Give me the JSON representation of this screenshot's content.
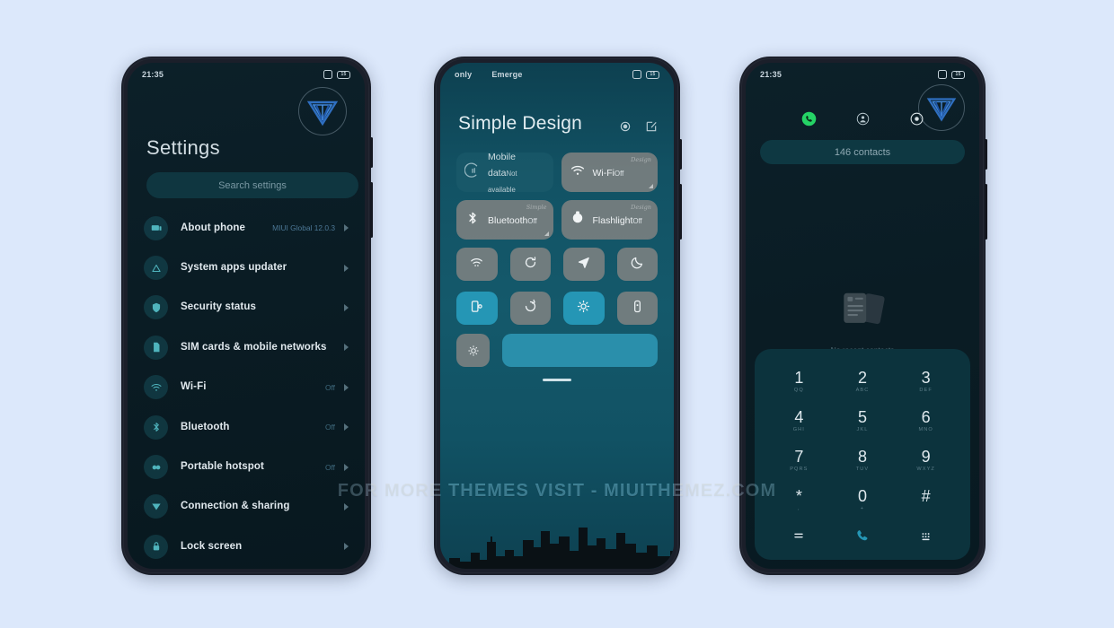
{
  "watermark": "FOR MORE THEMES VISIT - MIUITHEMEZ.COM",
  "colors": {
    "page_bg": "#dce8fb",
    "frame": "#1b1f2a",
    "settings_bg": "#0a1c24",
    "cc_bg": "#125264",
    "accent_teal": "#2596b5",
    "logo_blue": "#2f6fc0",
    "value_blue": "#4c7896"
  },
  "settings_phone": {
    "statusbar": {
      "time": "21:35",
      "icons": [
        "alarm-icon",
        "battery-icon"
      ],
      "battery_level": "15"
    },
    "logo": "miui-themez-logo",
    "title": "Settings",
    "search": {
      "placeholder": "Search settings"
    },
    "items": [
      {
        "icon": "about-phone-icon",
        "label": "About phone",
        "value": "MIUI Global 12.0.3",
        "value_style": "accent"
      },
      {
        "icon": "triangle-update-icon",
        "label": "System apps updater",
        "value": "",
        "value_style": "none"
      },
      {
        "icon": "shield-icon",
        "label": "Security status",
        "value": "",
        "value_style": "none"
      },
      {
        "icon": "sim-card-icon",
        "label": "SIM cards & mobile networks",
        "value": "",
        "value_style": "none"
      },
      {
        "icon": "wifi-icon",
        "label": "Wi-Fi",
        "value": "Off",
        "value_style": "dim"
      },
      {
        "icon": "bluetooth-icon",
        "label": "Bluetooth",
        "value": "Off",
        "value_style": "dim"
      },
      {
        "icon": "hotspot-icon",
        "label": "Portable hotspot",
        "value": "Off",
        "value_style": "dim"
      },
      {
        "icon": "connection-sharing-icon",
        "label": "Connection & sharing",
        "value": "",
        "value_style": "none"
      },
      {
        "icon": "lock-icon",
        "label": "Lock screen",
        "value": "",
        "value_style": "none"
      }
    ]
  },
  "control_center_phone": {
    "statusbar": {
      "carrier_left": "only",
      "carrier_right": "Emerge",
      "icons": [
        "alarm-icon",
        "battery-icon"
      ],
      "battery_level": "15"
    },
    "title": "Simple Design",
    "actions": [
      "settings-gear-icon",
      "edit-pencil-icon"
    ],
    "big_tiles": [
      {
        "icon": "mobile-data-icon",
        "name": "Mobile data",
        "sub": "Not available",
        "state": "unavailable",
        "script": "",
        "expandable": false
      },
      {
        "icon": "wifi-icon",
        "name": "Wi-Fi",
        "sub": "Off",
        "state": "off",
        "script": "Design",
        "expandable": true
      },
      {
        "icon": "bluetooth-icon",
        "name": "Bluetooth",
        "sub": "Off",
        "state": "off",
        "script": "Simple",
        "expandable": true
      },
      {
        "icon": "flashlight-icon",
        "name": "Flashlight",
        "sub": "Off",
        "state": "off",
        "script": "Design",
        "expandable": false
      }
    ],
    "quick_tiles": [
      {
        "icon": "wifi-hotspot-icon",
        "state": "off"
      },
      {
        "icon": "sync-rotate-icon",
        "state": "off"
      },
      {
        "icon": "location-arrow-icon",
        "state": "off"
      },
      {
        "icon": "moon-dnd-icon",
        "state": "off"
      },
      {
        "icon": "screen-cast-icon",
        "state": "on"
      },
      {
        "icon": "auto-rotate-icon",
        "state": "off"
      },
      {
        "icon": "reading-mode-icon",
        "state": "on"
      },
      {
        "icon": "power-saver-icon",
        "state": "off"
      }
    ],
    "brightness": {
      "icon": "brightness-auto-icon",
      "level_percent": 100
    },
    "handle": "drag-handle"
  },
  "dialer_phone": {
    "statusbar": {
      "time": "21:35",
      "icons": [
        "alarm-icon",
        "battery-icon"
      ],
      "battery_level": "15"
    },
    "logo": "miui-themez-logo",
    "tabs": [
      {
        "icon": "phone-call-icon",
        "active": true
      },
      {
        "icon": "contacts-person-icon",
        "active": false
      },
      {
        "icon": "call-recorder-icon",
        "active": false
      }
    ],
    "contacts_pill": "146 contacts",
    "empty_state": {
      "icon": "no-contacts-icon",
      "text": "No recent contacts"
    },
    "keypad": [
      {
        "num": "1",
        "sub": "QQ"
      },
      {
        "num": "2",
        "sub": "ABC"
      },
      {
        "num": "3",
        "sub": "DEF"
      },
      {
        "num": "4",
        "sub": "GHI"
      },
      {
        "num": "5",
        "sub": "JKL"
      },
      {
        "num": "6",
        "sub": "MNO"
      },
      {
        "num": "7",
        "sub": "PQRS"
      },
      {
        "num": "8",
        "sub": "TUV"
      },
      {
        "num": "9",
        "sub": "WXYZ"
      },
      {
        "num": "*",
        "sub": ","
      },
      {
        "num": "0",
        "sub": "+"
      },
      {
        "num": "#",
        "sub": ""
      }
    ],
    "bottom_actions": [
      {
        "icon": "menu-equals-icon"
      },
      {
        "icon": "call-green-icon"
      },
      {
        "icon": "keypad-dots-icon"
      }
    ]
  }
}
